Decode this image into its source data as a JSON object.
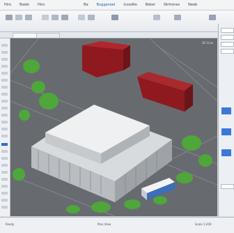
{
  "menu": {
    "items": [
      {
        "label": "Hiro"
      },
      {
        "label": "Baiek"
      },
      {
        "label": "Hiro"
      },
      {
        "label": "Ba"
      },
      {
        "label": "Bugganeel"
      },
      {
        "label": "Icoodile"
      },
      {
        "label": "Beker"
      },
      {
        "label": "Nirtrones"
      },
      {
        "label": "Neeb"
      }
    ]
  },
  "viewport": {
    "label": "3D View"
  },
  "status": {
    "left": "Ready",
    "mid": "Plan View",
    "right": "Scale 1:200"
  },
  "colors": {
    "accent": "#2e6fd1",
    "roof_red": "#8e1a1f",
    "grass": "#4fa63b",
    "facade": "#e7e9ec"
  }
}
